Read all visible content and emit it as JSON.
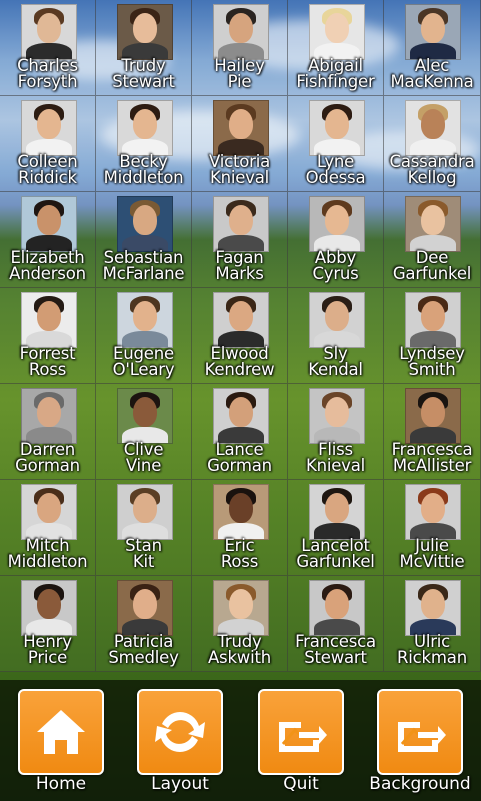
{
  "contacts": [
    {
      "first": "Charles",
      "last": "Forsyth",
      "skin": "#e0b896",
      "hair": "#5a3a22",
      "shirt": "#2b2b2b",
      "bg": "#d8d8d8"
    },
    {
      "first": "Trudy",
      "last": "Stewart",
      "skin": "#e7bc9a",
      "hair": "#3b2416",
      "shirt": "#3a3a3a",
      "bg": "#6b5a48"
    },
    {
      "first": "Hailey",
      "last": "Pie",
      "skin": "#d6a47e",
      "hair": "#2a2420",
      "shirt": "#8c8c8c",
      "bg": "#cfcfcf"
    },
    {
      "first": "Abigail",
      "last": "Fishfinger",
      "skin": "#f0d0b4",
      "hair": "#e8d59a",
      "shirt": "#f2f2f2",
      "bg": "#e6e6e6"
    },
    {
      "first": "Alec",
      "last": "MacKenna",
      "skin": "#e2b48e",
      "hair": "#4a3626",
      "shirt": "#1f2a44",
      "bg": "#9aa7b6"
    },
    {
      "first": "Colleen",
      "last": "Riddick",
      "skin": "#e4b690",
      "hair": "#2d1c12",
      "shirt": "#f2f2f2",
      "bg": "#d9d9d9"
    },
    {
      "first": "Becky",
      "last": "Middleton",
      "skin": "#e4b690",
      "hair": "#2d1c12",
      "shirt": "#f2f2f2",
      "bg": "#d9d9d9"
    },
    {
      "first": "Victoria",
      "last": "Knieval",
      "skin": "#e0ae88",
      "hair": "#5b3a20",
      "shirt": "#3a2a20",
      "bg": "#8b6a4a"
    },
    {
      "first": "Lyne",
      "last": "Odessa",
      "skin": "#e4b690",
      "hair": "#2d1c12",
      "shirt": "#f2f2f2",
      "bg": "#d9d9d9"
    },
    {
      "first": "Cassandra",
      "last": "Kellog",
      "skin": "#b98258",
      "hair": "#c4a067",
      "shirt": "#f0f0f0",
      "bg": "#e2e2e2"
    },
    {
      "first": "Elizabeth",
      "last": "Anderson",
      "skin": "#c9926a",
      "hair": "#1f1612",
      "shirt": "#232323",
      "bg": "#b0c8d8"
    },
    {
      "first": "Sebastian",
      "last": "McFarlane",
      "skin": "#d8a882",
      "hair": "#7a5a34",
      "shirt": "#3a4a66",
      "bg": "#2d4f74"
    },
    {
      "first": "Fagan",
      "last": "Marks",
      "skin": "#dfb08c",
      "hair": "#3b2a1c",
      "shirt": "#4a4a4a",
      "bg": "#c9c9c9"
    },
    {
      "first": "Abby",
      "last": "Cyrus",
      "skin": "#e6b892",
      "hair": "#5e3a1e",
      "shirt": "#e8e8e8",
      "bg": "#b8b8b8"
    },
    {
      "first": "Dee",
      "last": "Garfunkel",
      "skin": "#e9c2a0",
      "hair": "#8a5a2c",
      "shirt": "#d2d2d2",
      "bg": "#9f8c78"
    },
    {
      "first": "Forrest",
      "last": "Ross",
      "skin": "#d29c74",
      "hair": "#241a14",
      "shirt": "#d9d9d9",
      "bg": "#ececec"
    },
    {
      "first": "Eugene",
      "last": "O'Leary",
      "skin": "#e2b28c",
      "hair": "#4e3620",
      "shirt": "#7a8a9a",
      "bg": "#cdd6de"
    },
    {
      "first": "Elwood",
      "last": "Kendrew",
      "skin": "#dba882",
      "hair": "#3a2616",
      "shirt": "#2b2b2b",
      "bg": "#cfcfcf"
    },
    {
      "first": "Sly",
      "last": "Kendal",
      "skin": "#dcae8a",
      "hair": "#2a1e16",
      "shirt": "#d8d8d8",
      "bg": "#d2d2d2"
    },
    {
      "first": "Lyndsey",
      "last": "Smith",
      "skin": "#d9a27a",
      "hair": "#4a2a16",
      "shirt": "#6a6a6a",
      "bg": "#d0d0d0"
    },
    {
      "first": "Darren",
      "last": "Gorman",
      "skin": "#d8a886",
      "hair": "#6a6a6a",
      "shirt": "#8a8a8a",
      "bg": "#a8a8a8"
    },
    {
      "first": "Clive",
      "last": "Vine",
      "skin": "#8a5a3a",
      "hair": "#1c1410",
      "shirt": "#e8e8e8",
      "bg": "#6b8a4a"
    },
    {
      "first": "Lance",
      "last": "Gorman",
      "skin": "#d3a07a",
      "hair": "#2a1a10",
      "shirt": "#3a3a3a",
      "bg": "#cfcfcf"
    },
    {
      "first": "Fliss",
      "last": "Knieval",
      "skin": "#e6bc9c",
      "hair": "#6a4428",
      "shirt": "#b8b8b8",
      "bg": "#c4c4c4"
    },
    {
      "first": "Francesca",
      "last": "McAllister",
      "skin": "#c68e66",
      "hair": "#1a1410",
      "shirt": "#3a3a3a",
      "bg": "#8a6a4a"
    },
    {
      "first": "Mitch",
      "last": "Middleton",
      "skin": "#d9a680",
      "hair": "#4a2e1a",
      "shirt": "#e2e2e2",
      "bg": "#d6d6d6"
    },
    {
      "first": "Stan",
      "last": "Kit",
      "skin": "#dcae8a",
      "hair": "#5a3e24",
      "shirt": "#dedede",
      "bg": "#cfcfcf"
    },
    {
      "first": "Eric",
      "last": "Ross",
      "skin": "#6a4028",
      "hair": "#1a120e",
      "shirt": "#f0f0f0",
      "bg": "#b89a78"
    },
    {
      "first": "Lancelot",
      "last": "Garfunkel",
      "skin": "#d9a680",
      "hair": "#1e1610",
      "shirt": "#2a2a2a",
      "bg": "#d4d4d4"
    },
    {
      "first": "Julie",
      "last": "McVittie",
      "skin": "#e2ae88",
      "hair": "#8a3a1a",
      "shirt": "#4a4a4a",
      "bg": "#cfcfcf"
    },
    {
      "first": "Henry",
      "last": "Price",
      "skin": "#8a5a3a",
      "hair": "#1c1410",
      "shirt": "#e8e8e8",
      "bg": "#c8c8c8"
    },
    {
      "first": "Patricia",
      "last": "Smedley",
      "skin": "#e0ae8a",
      "hair": "#3a2214",
      "shirt": "#3a3a3a",
      "bg": "#8a6a4a"
    },
    {
      "first": "Trudy",
      "last": "Askwith",
      "skin": "#e9c2a0",
      "hair": "#8a5a2c",
      "shirt": "#d2d2d2",
      "bg": "#b8a890"
    },
    {
      "first": "Francesca",
      "last": "Stewart",
      "skin": "#d9a27a",
      "hair": "#2a1a12",
      "shirt": "#4a4a4a",
      "bg": "#c8c8c8"
    },
    {
      "first": "Ulric",
      "last": "Rickman",
      "skin": "#e0b28c",
      "hair": "#3a2818",
      "shirt": "#2a3a5a",
      "bg": "#d0d0d0"
    }
  ],
  "toolbar": {
    "home_label": "Home",
    "layout_label": "Layout",
    "quit_label": "Quit",
    "background_label": "Background"
  },
  "colors": {
    "button_orange": "#f29418",
    "button_border": "#ffffff",
    "toolbar_bg": "rgba(0,0,0,0.62)"
  }
}
